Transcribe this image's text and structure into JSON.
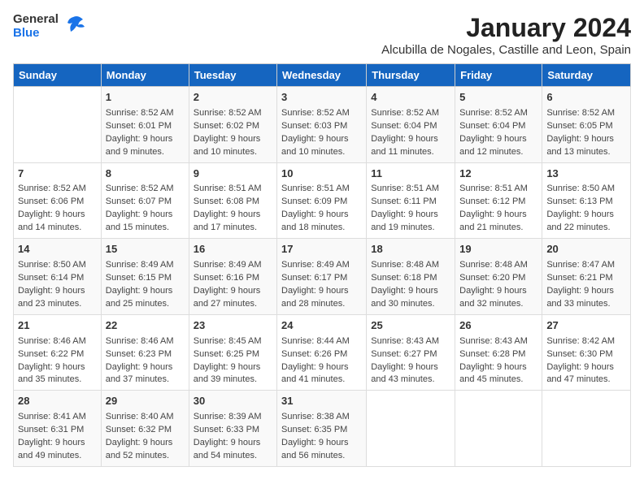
{
  "logo": {
    "general": "General",
    "blue": "Blue"
  },
  "title": "January 2024",
  "subtitle": "Alcubilla de Nogales, Castille and Leon, Spain",
  "days": [
    "Sunday",
    "Monday",
    "Tuesday",
    "Wednesday",
    "Thursday",
    "Friday",
    "Saturday"
  ],
  "weeks": [
    [
      {
        "day": "",
        "info": ""
      },
      {
        "day": "1",
        "info": "Sunrise: 8:52 AM\nSunset: 6:01 PM\nDaylight: 9 hours\nand 9 minutes."
      },
      {
        "day": "2",
        "info": "Sunrise: 8:52 AM\nSunset: 6:02 PM\nDaylight: 9 hours\nand 10 minutes."
      },
      {
        "day": "3",
        "info": "Sunrise: 8:52 AM\nSunset: 6:03 PM\nDaylight: 9 hours\nand 10 minutes."
      },
      {
        "day": "4",
        "info": "Sunrise: 8:52 AM\nSunset: 6:04 PM\nDaylight: 9 hours\nand 11 minutes."
      },
      {
        "day": "5",
        "info": "Sunrise: 8:52 AM\nSunset: 6:04 PM\nDaylight: 9 hours\nand 12 minutes."
      },
      {
        "day": "6",
        "info": "Sunrise: 8:52 AM\nSunset: 6:05 PM\nDaylight: 9 hours\nand 13 minutes."
      }
    ],
    [
      {
        "day": "7",
        "info": "Sunrise: 8:52 AM\nSunset: 6:06 PM\nDaylight: 9 hours\nand 14 minutes."
      },
      {
        "day": "8",
        "info": "Sunrise: 8:52 AM\nSunset: 6:07 PM\nDaylight: 9 hours\nand 15 minutes."
      },
      {
        "day": "9",
        "info": "Sunrise: 8:51 AM\nSunset: 6:08 PM\nDaylight: 9 hours\nand 17 minutes."
      },
      {
        "day": "10",
        "info": "Sunrise: 8:51 AM\nSunset: 6:09 PM\nDaylight: 9 hours\nand 18 minutes."
      },
      {
        "day": "11",
        "info": "Sunrise: 8:51 AM\nSunset: 6:11 PM\nDaylight: 9 hours\nand 19 minutes."
      },
      {
        "day": "12",
        "info": "Sunrise: 8:51 AM\nSunset: 6:12 PM\nDaylight: 9 hours\nand 21 minutes."
      },
      {
        "day": "13",
        "info": "Sunrise: 8:50 AM\nSunset: 6:13 PM\nDaylight: 9 hours\nand 22 minutes."
      }
    ],
    [
      {
        "day": "14",
        "info": "Sunrise: 8:50 AM\nSunset: 6:14 PM\nDaylight: 9 hours\nand 23 minutes."
      },
      {
        "day": "15",
        "info": "Sunrise: 8:49 AM\nSunset: 6:15 PM\nDaylight: 9 hours\nand 25 minutes."
      },
      {
        "day": "16",
        "info": "Sunrise: 8:49 AM\nSunset: 6:16 PM\nDaylight: 9 hours\nand 27 minutes."
      },
      {
        "day": "17",
        "info": "Sunrise: 8:49 AM\nSunset: 6:17 PM\nDaylight: 9 hours\nand 28 minutes."
      },
      {
        "day": "18",
        "info": "Sunrise: 8:48 AM\nSunset: 6:18 PM\nDaylight: 9 hours\nand 30 minutes."
      },
      {
        "day": "19",
        "info": "Sunrise: 8:48 AM\nSunset: 6:20 PM\nDaylight: 9 hours\nand 32 minutes."
      },
      {
        "day": "20",
        "info": "Sunrise: 8:47 AM\nSunset: 6:21 PM\nDaylight: 9 hours\nand 33 minutes."
      }
    ],
    [
      {
        "day": "21",
        "info": "Sunrise: 8:46 AM\nSunset: 6:22 PM\nDaylight: 9 hours\nand 35 minutes."
      },
      {
        "day": "22",
        "info": "Sunrise: 8:46 AM\nSunset: 6:23 PM\nDaylight: 9 hours\nand 37 minutes."
      },
      {
        "day": "23",
        "info": "Sunrise: 8:45 AM\nSunset: 6:25 PM\nDaylight: 9 hours\nand 39 minutes."
      },
      {
        "day": "24",
        "info": "Sunrise: 8:44 AM\nSunset: 6:26 PM\nDaylight: 9 hours\nand 41 minutes."
      },
      {
        "day": "25",
        "info": "Sunrise: 8:43 AM\nSunset: 6:27 PM\nDaylight: 9 hours\nand 43 minutes."
      },
      {
        "day": "26",
        "info": "Sunrise: 8:43 AM\nSunset: 6:28 PM\nDaylight: 9 hours\nand 45 minutes."
      },
      {
        "day": "27",
        "info": "Sunrise: 8:42 AM\nSunset: 6:30 PM\nDaylight: 9 hours\nand 47 minutes."
      }
    ],
    [
      {
        "day": "28",
        "info": "Sunrise: 8:41 AM\nSunset: 6:31 PM\nDaylight: 9 hours\nand 49 minutes."
      },
      {
        "day": "29",
        "info": "Sunrise: 8:40 AM\nSunset: 6:32 PM\nDaylight: 9 hours\nand 52 minutes."
      },
      {
        "day": "30",
        "info": "Sunrise: 8:39 AM\nSunset: 6:33 PM\nDaylight: 9 hours\nand 54 minutes."
      },
      {
        "day": "31",
        "info": "Sunrise: 8:38 AM\nSunset: 6:35 PM\nDaylight: 9 hours\nand 56 minutes."
      },
      {
        "day": "",
        "info": ""
      },
      {
        "day": "",
        "info": ""
      },
      {
        "day": "",
        "info": ""
      }
    ]
  ]
}
